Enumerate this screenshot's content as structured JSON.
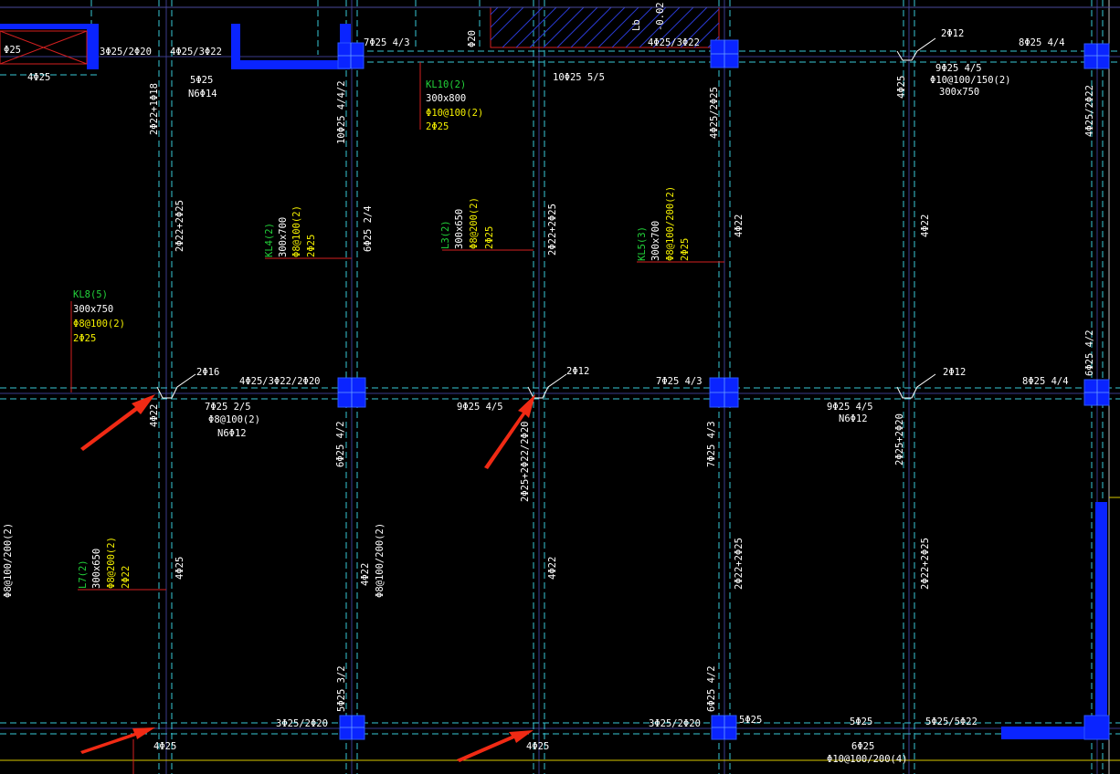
{
  "drawing": {
    "background": "#000000",
    "colors": {
      "beam_line": "#37c8d6",
      "column": "#0a24ff",
      "leader": "#d42020",
      "label_name": "#22d33a",
      "label_stirrup": "#f4f000",
      "label_text": "#ffffff",
      "arrow": "#f02a14"
    }
  },
  "annotations": {
    "top_a1": "3Φ25/2Φ20",
    "top_a2": "4Φ25/3Φ22",
    "top_a3": "7Φ25 4/3",
    "top_a4": "4Φ25/3Φ22",
    "top_a5": "2Φ12",
    "top_a6": "8Φ25 4/4",
    "top_b1": "Φ25",
    "top_b2": "4Φ25",
    "top_b3": "5Φ25",
    "top_b4": "N6Φ14",
    "top_b5": "10Φ25 5/5",
    "top_b6": "9Φ25 4/5",
    "top_b7": "Φ10@100/150(2)",
    "top_b8": "300x750",
    "top_b9": "Φ20",
    "mid_a1": "2Φ16",
    "mid_a2": "4Φ25/3Φ22/2Φ20",
    "mid_a3": "2Φ12",
    "mid_a4": "7Φ25 4/3",
    "mid_a5": "2Φ12",
    "mid_a6": "8Φ25 4/4",
    "mid_b1": "7Φ25 2/5",
    "mid_b2": "Φ8@100(2)",
    "mid_b3": "N6Φ12",
    "mid_b4": "9Φ25 4/5",
    "mid_b5": "9Φ25 4/5",
    "mid_b6": "N6Φ12",
    "bot_a1": "3Φ25/2Φ20",
    "bot_a2": "3Φ25/2Φ20",
    "bot_a3": "5Φ25",
    "bot_a4": "5Φ25",
    "bot_a5": "5Φ25/5Φ22",
    "bot_b1": "4Φ25",
    "bot_b2": "4Φ25",
    "bot_b3": "6Φ25",
    "bot_b4": "Φ10@100/200(4)",
    "v_1": "2Φ22+1Φ18",
    "v_2": "2Φ22+2Φ25",
    "v_3": "10Φ25 4/4/2",
    "v_4": "6Φ25 2/4",
    "v_5": "2Φ22+2Φ25",
    "v_6": "4Φ25/2Φ25",
    "v_7": "4Φ22",
    "v_8": "4Φ25",
    "v_9": "4Φ22",
    "v_10": "4Φ25/2Φ22",
    "v_11": "6Φ25 4/2",
    "v_12": "4Φ22",
    "v_13": "6Φ25 4/2",
    "v_14": "2Φ25+2Φ22/2Φ20",
    "v_15": "7Φ25 4/3",
    "v_16": "2Φ25+2Φ20",
    "v_17": "Φ8@100/200(2)",
    "v_18": "4Φ25",
    "v_19": "4Φ22",
    "v_20": "Φ8@100/200(2)",
    "v_21": "4Φ22",
    "v_22": "2Φ22+2Φ25",
    "v_23": "2Φ22+2Φ25",
    "v_24": "5Φ25 3/2",
    "v_25": "6Φ25 4/2",
    "v_26": "Lb",
    "v_27": "-0.02",
    "v_28": "Φ20"
  },
  "beams": {
    "kl10": {
      "name": "KL10(2)",
      "size": "300x800",
      "stirrup": "Φ10@100(2)",
      "bars": "2Φ25"
    },
    "kl8": {
      "name": "KL8(5)",
      "size": "300x750",
      "stirrup": "Φ8@100(2)",
      "bars": "2Φ25"
    },
    "kl4": {
      "name": "KL4(2)",
      "size": "300x700",
      "stirrup": "Φ8@100(2)",
      "bars": "2Φ25"
    },
    "l3": {
      "name": "L3(2)",
      "size": "300x650",
      "stirrup": "Φ8@200(2)",
      "bars": "2Φ25"
    },
    "kl5": {
      "name": "KL5(3)",
      "size": "300x700",
      "stirrup": "Φ8@100/200(2)",
      "bars": "2Φ25"
    },
    "l7": {
      "name": "L7(2)",
      "size": "300x650",
      "stirrup": "Φ8@200(2)",
      "bars": "2Φ22"
    }
  },
  "markers": [
    "arrow-1",
    "arrow-2",
    "arrow-3",
    "arrow-4"
  ]
}
